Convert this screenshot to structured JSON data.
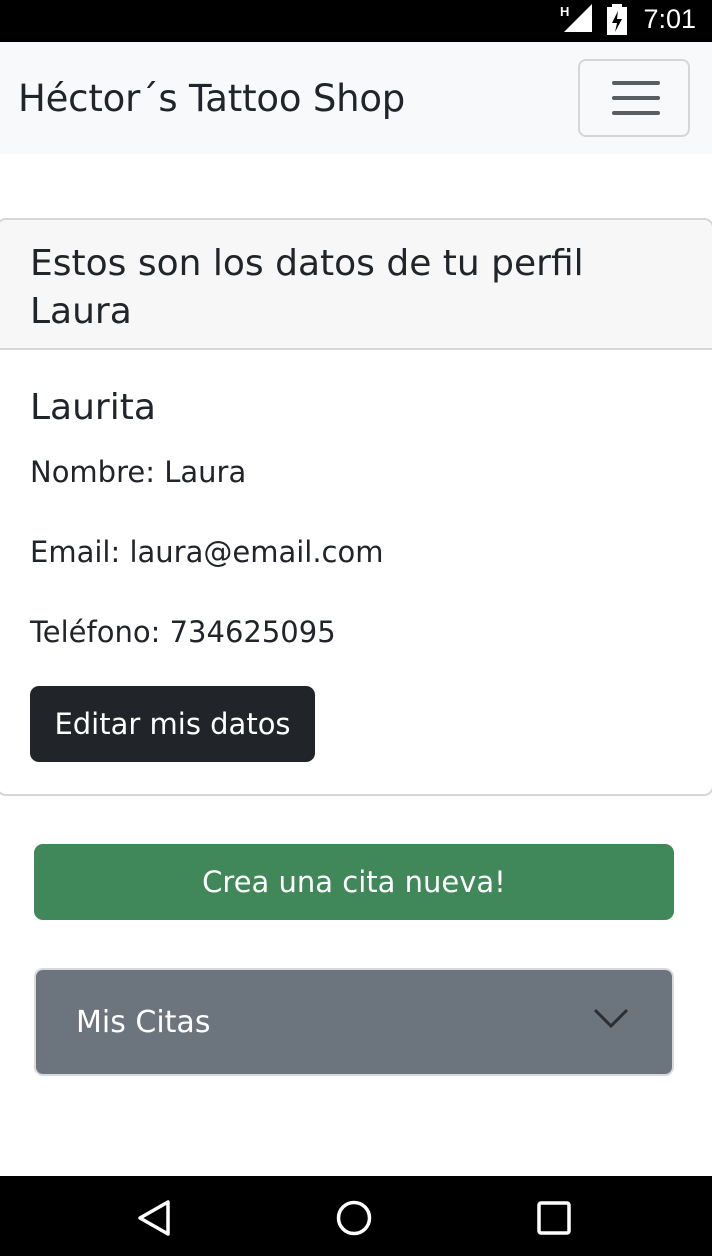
{
  "status_bar": {
    "time": "7:01",
    "network_label": "H",
    "icons": [
      "signal-icon",
      "battery-charging-icon"
    ]
  },
  "navbar": {
    "brand": "Héctor´s Tattoo Shop",
    "toggler_icon": "hamburger-menu-icon"
  },
  "profile_card": {
    "header": "Estos son los datos de tu perfil Laura",
    "username": "Laurita",
    "fields": {
      "name": "Nombre: Laura",
      "email": "Email: laura@email.com",
      "phone": "Teléfono: 734625095"
    },
    "edit_button": "Editar mis datos"
  },
  "new_appointment_button": "Crea una cita nueva!",
  "appointments_accordion": {
    "label": "Mis Citas",
    "icon": "chevron-down-icon"
  },
  "system_nav": {
    "icons": [
      "back-icon",
      "home-icon",
      "recents-icon"
    ]
  },
  "colors": {
    "navbar_bg": "#f8f9fa",
    "dark_button": "#212529",
    "green_button": "#408759",
    "accordion_bg": "#6c757d"
  }
}
